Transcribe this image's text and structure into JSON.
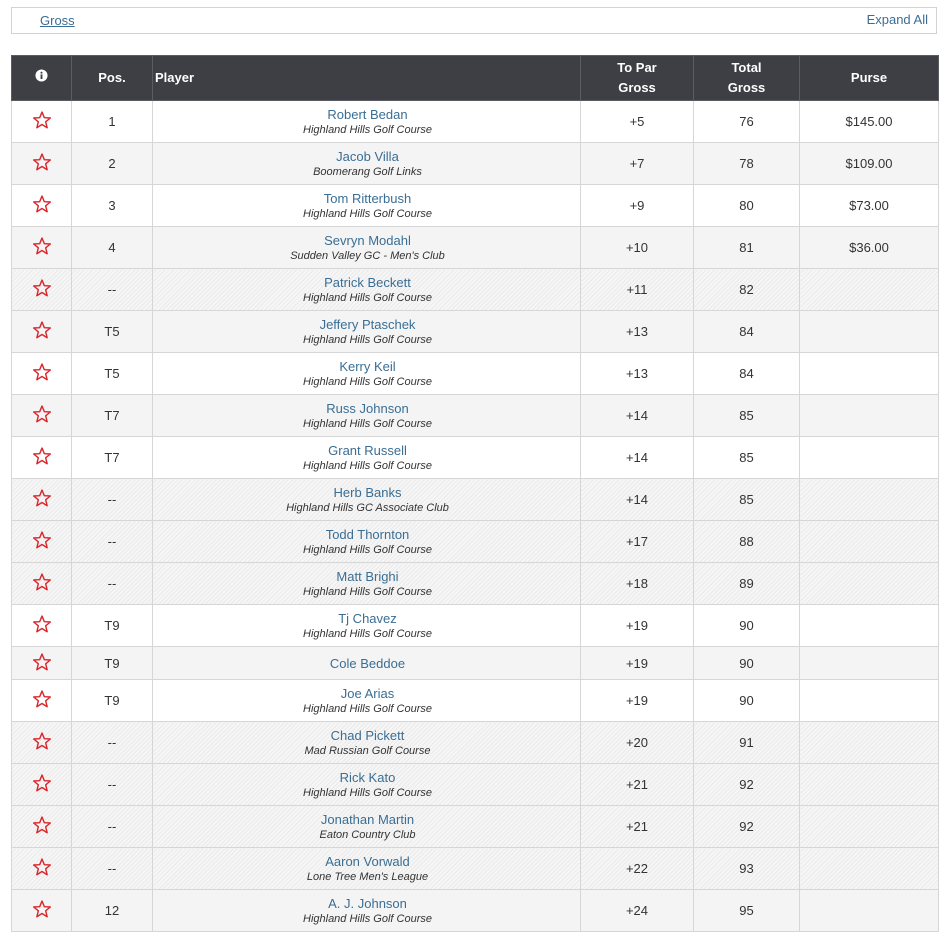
{
  "toolbar": {
    "gross_label": "Gross",
    "expand_label": "Expand All"
  },
  "headers": {
    "info_icon": "info-icon",
    "pos": "Pos.",
    "player": "Player",
    "to_par_line1": "To Par",
    "to_par_line2": "Gross",
    "total_line1": "Total",
    "total_line2": "Gross",
    "purse": "Purse"
  },
  "colors": {
    "header_bg": "#3d3f45",
    "link": "#3a6e94",
    "star": "#d9262b"
  },
  "rows": [
    {
      "pos": "1",
      "name": "Robert Bedan",
      "club": "Highland Hills Golf Course",
      "to_par": "+5",
      "total": "76",
      "purse": "$145.00",
      "style": "plain"
    },
    {
      "pos": "2",
      "name": "Jacob Villa",
      "club": "Boomerang Golf Links",
      "to_par": "+7",
      "total": "78",
      "purse": "$109.00",
      "style": "even"
    },
    {
      "pos": "3",
      "name": "Tom Ritterbush",
      "club": "Highland Hills Golf Course",
      "to_par": "+9",
      "total": "80",
      "purse": "$73.00",
      "style": "plain"
    },
    {
      "pos": "4",
      "name": "Sevryn Modahl",
      "club": "Sudden Valley GC - Men's Club",
      "to_par": "+10",
      "total": "81",
      "purse": "$36.00",
      "style": "even"
    },
    {
      "pos": "--",
      "name": "Patrick Beckett",
      "club": "Highland Hills Golf Course",
      "to_par": "+11",
      "total": "82",
      "purse": "",
      "style": "hatched"
    },
    {
      "pos": "T5",
      "name": "Jeffery Ptaschek",
      "club": "Highland Hills Golf Course",
      "to_par": "+13",
      "total": "84",
      "purse": "",
      "style": "even"
    },
    {
      "pos": "T5",
      "name": "Kerry Keil",
      "club": "Highland Hills Golf Course",
      "to_par": "+13",
      "total": "84",
      "purse": "",
      "style": "plain"
    },
    {
      "pos": "T7",
      "name": "Russ Johnson",
      "club": "Highland Hills Golf Course",
      "to_par": "+14",
      "total": "85",
      "purse": "",
      "style": "even"
    },
    {
      "pos": "T7",
      "name": "Grant Russell",
      "club": "Highland Hills Golf Course",
      "to_par": "+14",
      "total": "85",
      "purse": "",
      "style": "plain"
    },
    {
      "pos": "--",
      "name": "Herb Banks",
      "club": "Highland Hills GC Associate Club",
      "to_par": "+14",
      "total": "85",
      "purse": "",
      "style": "hatched"
    },
    {
      "pos": "--",
      "name": "Todd Thornton",
      "club": "Highland Hills Golf Course",
      "to_par": "+17",
      "total": "88",
      "purse": "",
      "style": "hatched"
    },
    {
      "pos": "--",
      "name": "Matt Brighi",
      "club": "Highland Hills Golf Course",
      "to_par": "+18",
      "total": "89",
      "purse": "",
      "style": "hatched"
    },
    {
      "pos": "T9",
      "name": "Tj Chavez",
      "club": "Highland Hills Golf Course",
      "to_par": "+19",
      "total": "90",
      "purse": "",
      "style": "plain"
    },
    {
      "pos": "T9",
      "name": "Cole Beddoe",
      "club": "",
      "to_par": "+19",
      "total": "90",
      "purse": "",
      "style": "even"
    },
    {
      "pos": "T9",
      "name": "Joe Arias",
      "club": "Highland Hills Golf Course",
      "to_par": "+19",
      "total": "90",
      "purse": "",
      "style": "plain"
    },
    {
      "pos": "--",
      "name": "Chad Pickett",
      "club": "Mad Russian Golf Course",
      "to_par": "+20",
      "total": "91",
      "purse": "",
      "style": "hatched"
    },
    {
      "pos": "--",
      "name": "Rick Kato",
      "club": "Highland Hills Golf Course",
      "to_par": "+21",
      "total": "92",
      "purse": "",
      "style": "hatched"
    },
    {
      "pos": "--",
      "name": "Jonathan Martin",
      "club": "Eaton Country Club",
      "to_par": "+21",
      "total": "92",
      "purse": "",
      "style": "hatched"
    },
    {
      "pos": "--",
      "name": "Aaron Vorwald",
      "club": "Lone Tree Men's League",
      "to_par": "+22",
      "total": "93",
      "purse": "",
      "style": "hatched"
    },
    {
      "pos": "12",
      "name": "A. J. Johnson",
      "club": "Highland Hills Golf Course",
      "to_par": "+24",
      "total": "95",
      "purse": "",
      "style": "even"
    }
  ]
}
